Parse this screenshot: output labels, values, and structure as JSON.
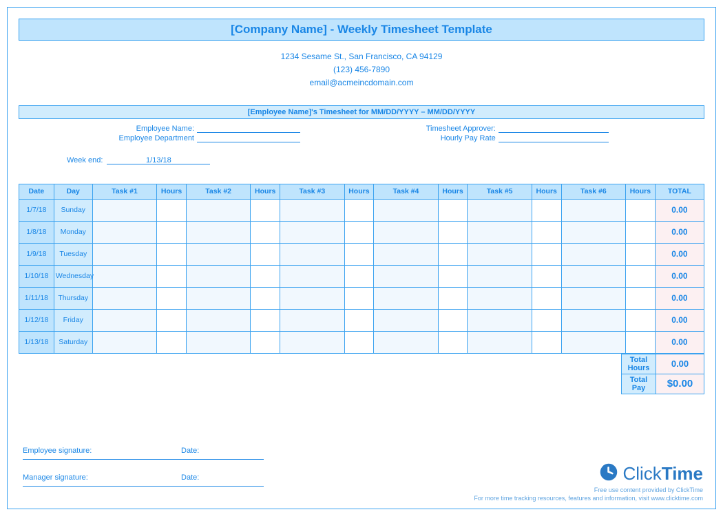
{
  "title": "[Company Name] - Weekly Timesheet Template",
  "contact": {
    "address": "1234 Sesame St.,  San Francisco, CA 94129",
    "phone": "(123) 456-7890",
    "email": "email@acmeincdomain.com"
  },
  "subheading": "[Employee Name]'s Timesheet for MM/DD/YYYY – MM/DD/YYYY",
  "meta": {
    "employee_name_label": "Employee Name:",
    "employee_dept_label": "Employee Department",
    "approver_label": "Timesheet Approver:",
    "rate_label": "Hourly Pay Rate",
    "week_end_label": "Week end:",
    "week_end_value": "1/13/18"
  },
  "headers": {
    "date": "Date",
    "day": "Day",
    "task1": "Task #1",
    "task2": "Task #2",
    "task3": "Task #3",
    "task4": "Task #4",
    "task5": "Task #5",
    "task6": "Task #6",
    "hours": "Hours",
    "total": "TOTAL"
  },
  "rows": [
    {
      "date": "1/7/18",
      "day": "Sunday",
      "total": "0.00"
    },
    {
      "date": "1/8/18",
      "day": "Monday",
      "total": "0.00"
    },
    {
      "date": "1/9/18",
      "day": "Tuesday",
      "total": "0.00"
    },
    {
      "date": "1/10/18",
      "day": "Wednesday",
      "total": "0.00"
    },
    {
      "date": "1/11/18",
      "day": "Thursday",
      "total": "0.00"
    },
    {
      "date": "1/12/18",
      "day": "Friday",
      "total": "0.00"
    },
    {
      "date": "1/13/18",
      "day": "Saturday",
      "total": "0.00"
    }
  ],
  "summary": {
    "total_hours_label": "Total Hours",
    "total_hours_value": "0.00",
    "total_pay_label": "Total Pay",
    "total_pay_value": "$0.00"
  },
  "signatures": {
    "employee": "Employee signature:",
    "manager": "Manager signature:",
    "date": "Date:"
  },
  "brand": {
    "name_light": "Click",
    "name_bold": "Time",
    "tag1": "Free use content provided by ClickTime",
    "tag2": "For more time tracking resources, features and information, visit www.clicktime.com"
  }
}
